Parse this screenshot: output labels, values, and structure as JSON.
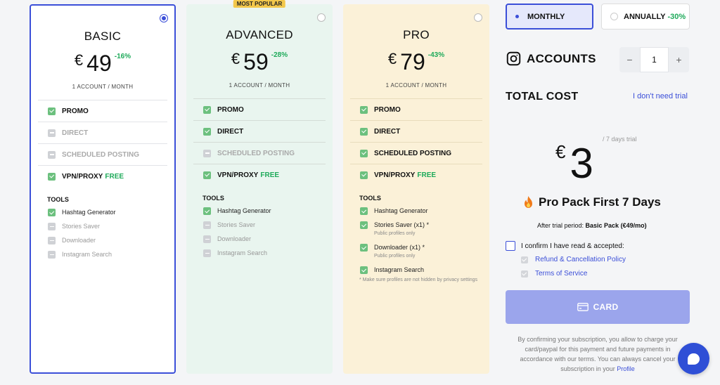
{
  "plans": [
    {
      "name": "BASIC",
      "currency": "€",
      "price": "49",
      "discount": "-16%",
      "per": "1 ACCOUNT / MONTH",
      "badge": "",
      "features": [
        {
          "label": "PROMO",
          "on": true,
          "free": ""
        },
        {
          "label": "DIRECT",
          "on": false,
          "free": ""
        },
        {
          "label": "SCHEDULED POSTING",
          "on": false,
          "free": ""
        },
        {
          "label": "VPN/PROXY",
          "on": true,
          "free": "FREE"
        }
      ],
      "tools_heading": "TOOLS",
      "tools": [
        {
          "label": "Hashtag Generator",
          "on": true,
          "sub": ""
        },
        {
          "label": "Stories Saver",
          "on": false,
          "sub": ""
        },
        {
          "label": "Downloader",
          "on": false,
          "sub": ""
        },
        {
          "label": "Instagram Search",
          "on": false,
          "sub": ""
        }
      ],
      "note": ""
    },
    {
      "name": "ADVANCED",
      "currency": "€",
      "price": "59",
      "discount": "-28%",
      "per": "1 ACCOUNT / MONTH",
      "badge": "MOST POPULAR",
      "features": [
        {
          "label": "PROMO",
          "on": true,
          "free": ""
        },
        {
          "label": "DIRECT",
          "on": true,
          "free": ""
        },
        {
          "label": "SCHEDULED POSTING",
          "on": false,
          "free": ""
        },
        {
          "label": "VPN/PROXY",
          "on": true,
          "free": "FREE"
        }
      ],
      "tools_heading": "TOOLS",
      "tools": [
        {
          "label": "Hashtag Generator",
          "on": true,
          "sub": ""
        },
        {
          "label": "Stories Saver",
          "on": false,
          "sub": ""
        },
        {
          "label": "Downloader",
          "on": false,
          "sub": ""
        },
        {
          "label": "Instagram Search",
          "on": false,
          "sub": ""
        }
      ],
      "note": ""
    },
    {
      "name": "PRO",
      "currency": "€",
      "price": "79",
      "discount": "-43%",
      "per": "1 ACCOUNT / MONTH",
      "badge": "",
      "features": [
        {
          "label": "PROMO",
          "on": true,
          "free": ""
        },
        {
          "label": "DIRECT",
          "on": true,
          "free": ""
        },
        {
          "label": "SCHEDULED POSTING",
          "on": true,
          "free": ""
        },
        {
          "label": "VPN/PROXY",
          "on": true,
          "free": "FREE"
        }
      ],
      "tools_heading": "TOOLS",
      "tools": [
        {
          "label": "Hashtag Generator",
          "on": true,
          "sub": ""
        },
        {
          "label": "Stories Saver (x1) *",
          "on": true,
          "sub": "Public profiles only"
        },
        {
          "label": "Downloader (x1) *",
          "on": true,
          "sub": "Public profiles only"
        },
        {
          "label": "Instagram Search",
          "on": true,
          "sub": ""
        }
      ],
      "note": "* Make sure profiles are not hidden by privacy settings"
    }
  ],
  "billing": {
    "monthly_label": "MONTHLY",
    "annually_label": "ANNUALLY",
    "annually_discount": "-30%"
  },
  "accounts": {
    "label": "ACCOUNTS",
    "minus": "−",
    "plus": "+",
    "quantity": "1"
  },
  "summary": {
    "total_label": "TOTAL COST",
    "no_trial_link": "I don't need trial",
    "currency": "€",
    "amount": "3",
    "trial_period": "/ 7 days trial",
    "pack_title": "Pro Pack First 7 Days",
    "after_prefix": "After trial period: ",
    "after_value": "Basic Pack (€49/mo)",
    "confirm_label": "I confirm I have read & accepted:",
    "refund_link": "Refund & Cancellation Policy",
    "terms_link": "Terms of Service",
    "card_button": "CARD",
    "legal_text": "By confirming your subscription, you allow to charge your card/paypal for this payment and future payments in accordance with our terms. You can always cancel your subscription in your ",
    "legal_link": "Profile"
  },
  "colors": {
    "accent": "#3b4fd8",
    "green": "#1eaa5a",
    "advanced_bg": "#e9f5ef",
    "pro_bg": "#fbf1d8",
    "badge": "#f3c84b"
  }
}
